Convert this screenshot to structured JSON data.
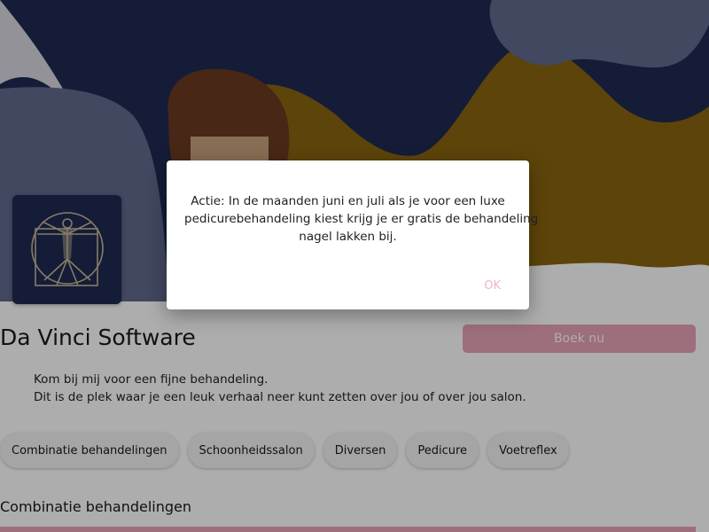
{
  "business": {
    "name": "Da Vinci Software",
    "book_label": "Boek nu"
  },
  "intro": {
    "lines": [
      "Kom bij mij voor een fijne behandeling.",
      "Dit is de plek waar je een leuk verhaal neer kunt zetten over jou of over jou salon."
    ]
  },
  "categories": [
    "Combinatie behandelingen",
    "Schoonheidssalon",
    "Diversen",
    "Pedicure",
    "Voetreflex"
  ],
  "section": {
    "title": "Combinatie behandelingen"
  },
  "dialog": {
    "lines": [
      "Actie: In de maanden juni en juli als je voor een luxe",
      "pedicurebehandeling kiest krijg je er gratis de behandeling",
      "nagel lakken bij."
    ],
    "ok_label": "OK"
  },
  "colors": {
    "navy": "#1e2a52",
    "mustard": "#8a6510",
    "slate": "#616a8c",
    "pink": "#e8a2b5",
    "hair": "#6b3a22",
    "skin": "#c9a27c"
  }
}
